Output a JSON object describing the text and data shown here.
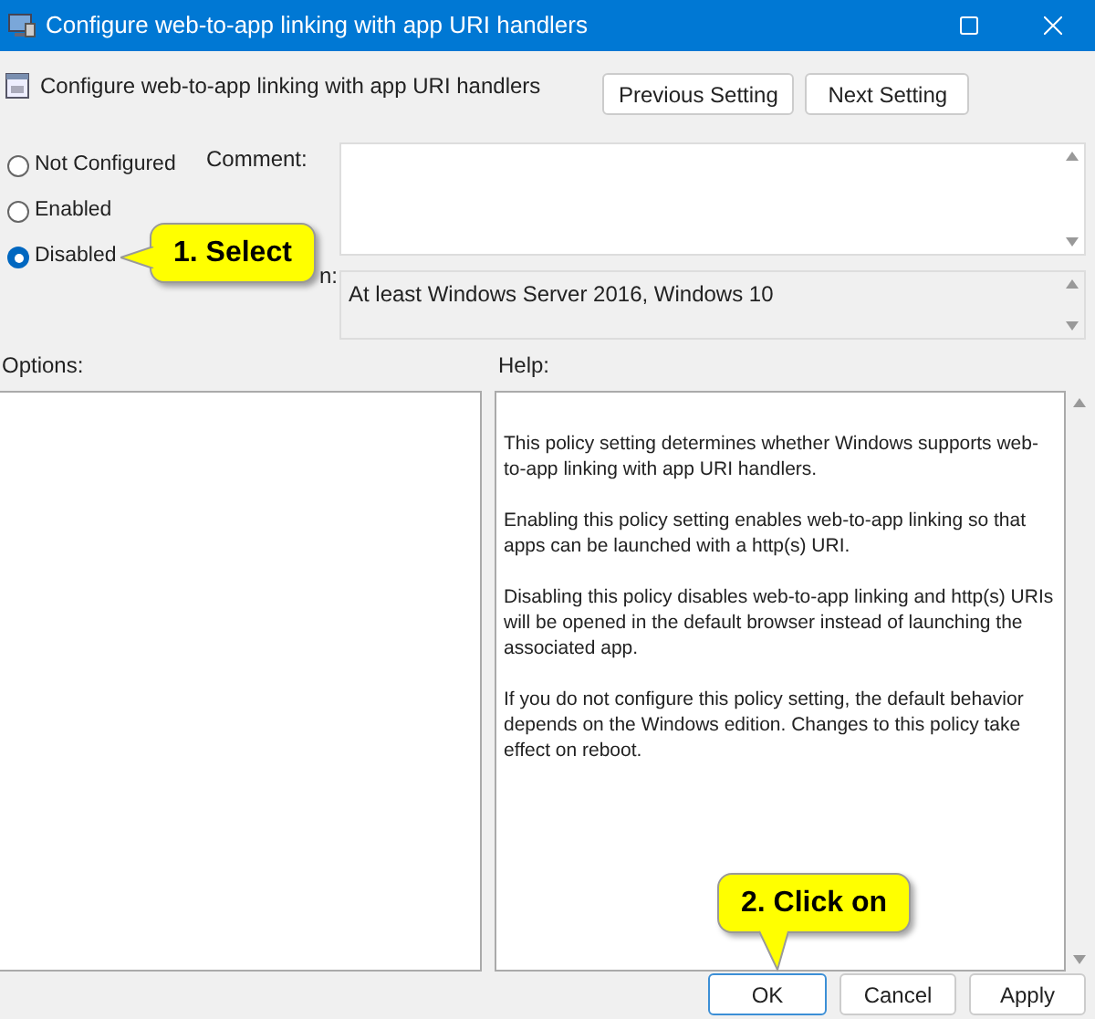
{
  "window": {
    "title": "Configure web-to-app linking with app URI handlers"
  },
  "header": {
    "policy_name": "Configure web-to-app linking with app URI handlers",
    "buttons": [
      "Previous Setting",
      "Next Setting"
    ]
  },
  "state_options": [
    {
      "label": "Not Configured",
      "selected": false
    },
    {
      "label": "Enabled",
      "selected": false
    },
    {
      "label": "Disabled",
      "selected": true
    }
  ],
  "comment": {
    "label": "Comment:"
  },
  "supported_on": {
    "label": "n:",
    "value": "At least Windows Server 2016, Windows 10"
  },
  "options": {
    "label": "Options:"
  },
  "help": {
    "label": "Help:",
    "paragraphs": [
      "This policy setting determines whether Windows supports web-to-app linking with app URI handlers.",
      "Enabling this policy setting enables web-to-app linking so that apps can be launched with a http(s) URI.",
      "Disabling this policy disables web-to-app linking and http(s) URIs will be opened in the default browser instead of launching the associated app.",
      "If you do not configure this policy setting, the default behavior depends on the Windows edition. Changes to this policy take effect on reboot."
    ]
  },
  "footer_buttons": [
    {
      "label": "OK",
      "kind": "default"
    },
    {
      "label": "Cancel",
      "kind": "normal"
    },
    {
      "label": "Apply",
      "kind": "normal"
    }
  ],
  "callouts": [
    {
      "text": "1. Select",
      "kind": "pointing-left"
    },
    {
      "text": "2. Click on",
      "kind": "pointing-down"
    }
  ]
}
